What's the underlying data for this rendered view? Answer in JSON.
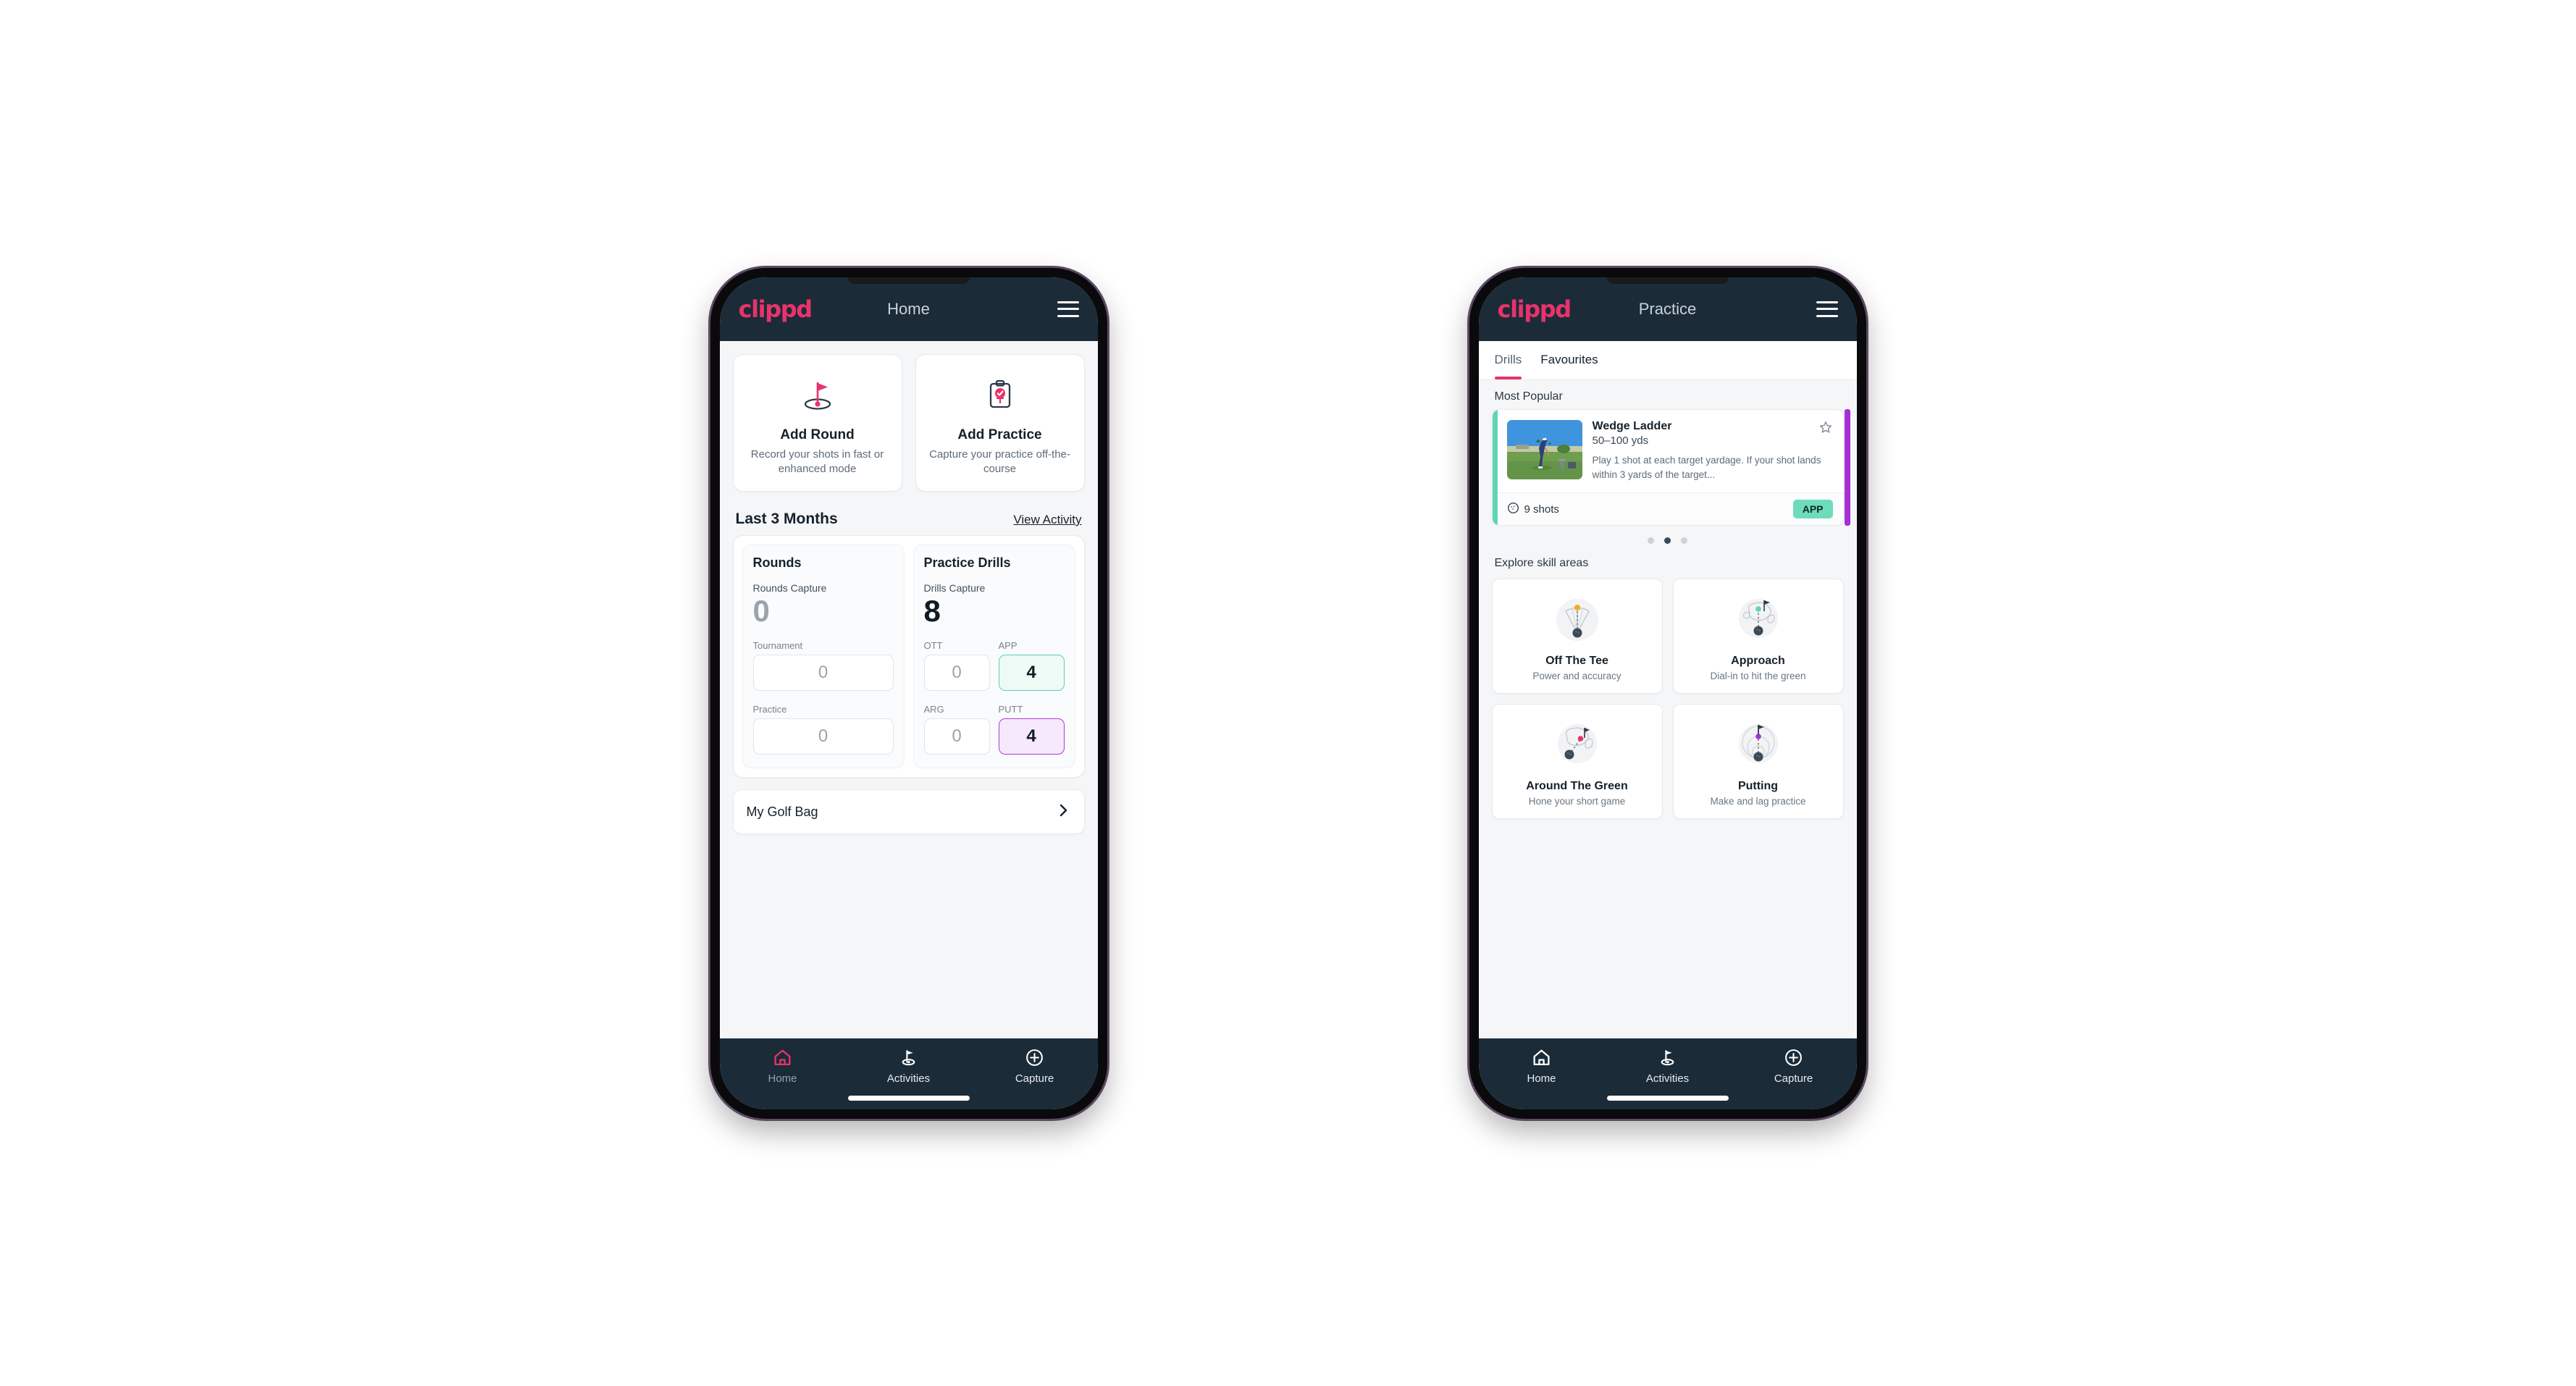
{
  "brand": {
    "logo_text": "clippd",
    "accent_pink": "#e8336a",
    "header_bg": "#1b2b38",
    "green": "#6edcbb",
    "purple": "#a62fd6"
  },
  "home": {
    "header": {
      "title": "Home",
      "menu_icon": "hamburger-icon",
      "logo": "clippd"
    },
    "tiles": [
      {
        "icon": "golf-flag-hole-icon",
        "title": "Add Round",
        "subtitle": "Record your shots in fast or enhanced mode"
      },
      {
        "icon": "clipboard-check-icon",
        "title": "Add Practice",
        "subtitle": "Capture your practice off-the-course"
      }
    ],
    "section": {
      "title": "Last 3 Months",
      "link": "View Activity"
    },
    "rounds": {
      "title": "Rounds",
      "capture_label": "Rounds Capture",
      "capture_value": "0",
      "fields": [
        {
          "label": "Tournament",
          "value": "0",
          "style": "plain"
        },
        {
          "label": "Practice",
          "value": "0",
          "style": "plain"
        }
      ]
    },
    "drills": {
      "title": "Practice Drills",
      "capture_label": "Drills Capture",
      "capture_value": "8",
      "fields": [
        {
          "label": "OTT",
          "value": "0",
          "style": "plain"
        },
        {
          "label": "APP",
          "value": "4",
          "style": "green"
        },
        {
          "label": "ARG",
          "value": "0",
          "style": "plain"
        },
        {
          "label": "PUTT",
          "value": "4",
          "style": "purple"
        }
      ]
    },
    "golf_bag": {
      "label": "My Golf Bag",
      "chevron": "chevron-right-icon"
    },
    "nav": [
      {
        "icon": "home-icon",
        "label": "Home",
        "active": true
      },
      {
        "icon": "golf-flag-icon",
        "label": "Activities",
        "active": false
      },
      {
        "icon": "plus-circle-icon",
        "label": "Capture",
        "active": false
      }
    ]
  },
  "practice": {
    "header": {
      "title": "Practice",
      "menu_icon": "hamburger-icon",
      "logo": "clippd"
    },
    "tabs": [
      {
        "label": "Drills",
        "active": true
      },
      {
        "label": "Favourites",
        "active": false
      }
    ],
    "most_popular_label": "Most Popular",
    "drill_card": {
      "title": "Wedge Ladder",
      "yardage": "50–100 yds",
      "description": "Play 1 shot at each target yardage. If your shot lands within 3 yards of the target...",
      "shots": "9 shots",
      "shots_icon": "golf-ball-icon",
      "badge": "APP",
      "star_icon": "star-outline-icon",
      "accent_color": "#5fd6b3",
      "next_accent_color": "#a62fd6",
      "thumbnail_alt": "golfer hitting wedge shot on practice range"
    },
    "carousel_dots": {
      "count": 3,
      "active_index": 1
    },
    "explore_label": "Explore skill areas",
    "skill_cards": [
      {
        "icon": "off-the-tee-icon",
        "title": "Off The Tee",
        "subtitle": "Power and accuracy"
      },
      {
        "icon": "approach-icon",
        "title": "Approach",
        "subtitle": "Dial-in to hit the green"
      },
      {
        "icon": "around-the-green-icon",
        "title": "Around The Green",
        "subtitle": "Hone your short game"
      },
      {
        "icon": "putting-icon",
        "title": "Putting",
        "subtitle": "Make and lag practice"
      }
    ],
    "nav": [
      {
        "icon": "home-icon",
        "label": "Home",
        "active": false
      },
      {
        "icon": "golf-flag-icon",
        "label": "Activities",
        "active": true
      },
      {
        "icon": "plus-circle-icon",
        "label": "Capture",
        "active": false
      }
    ]
  }
}
